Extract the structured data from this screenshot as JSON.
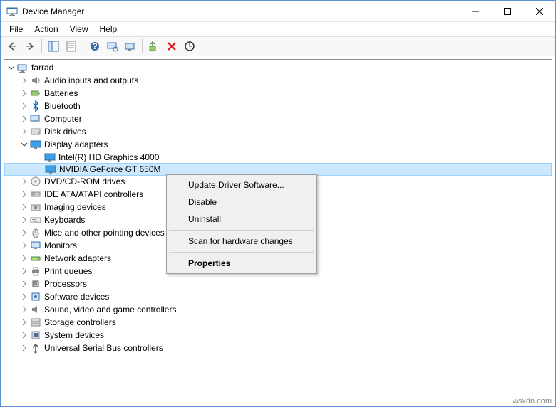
{
  "window": {
    "title": "Device Manager"
  },
  "menubar": {
    "file": "File",
    "action": "Action",
    "view": "View",
    "help": "Help"
  },
  "tree": {
    "root": "farrad",
    "items": [
      {
        "label": "Audio inputs and outputs",
        "icon": "audio",
        "expanded": false
      },
      {
        "label": "Batteries",
        "icon": "battery",
        "expanded": false
      },
      {
        "label": "Bluetooth",
        "icon": "bluetooth",
        "expanded": false
      },
      {
        "label": "Computer",
        "icon": "computer",
        "expanded": false
      },
      {
        "label": "Disk drives",
        "icon": "disk",
        "expanded": false
      },
      {
        "label": "Display adapters",
        "icon": "display",
        "expanded": true,
        "children": [
          {
            "label": "Intel(R) HD Graphics 4000",
            "icon": "display"
          },
          {
            "label": "NVIDIA GeForce GT 650M",
            "icon": "display",
            "selected": true
          }
        ]
      },
      {
        "label": "DVD/CD-ROM drives",
        "icon": "dvd",
        "expanded": false
      },
      {
        "label": "IDE ATA/ATAPI controllers",
        "icon": "ide",
        "expanded": false
      },
      {
        "label": "Imaging devices",
        "icon": "imaging",
        "expanded": false
      },
      {
        "label": "Keyboards",
        "icon": "keyboard",
        "expanded": false
      },
      {
        "label": "Mice and other pointing devices",
        "icon": "mouse",
        "expanded": false
      },
      {
        "label": "Monitors",
        "icon": "monitor",
        "expanded": false
      },
      {
        "label": "Network adapters",
        "icon": "network",
        "expanded": false
      },
      {
        "label": "Print queues",
        "icon": "printer",
        "expanded": false
      },
      {
        "label": "Processors",
        "icon": "processor",
        "expanded": false
      },
      {
        "label": "Software devices",
        "icon": "software",
        "expanded": false
      },
      {
        "label": "Sound, video and game controllers",
        "icon": "sound",
        "expanded": false
      },
      {
        "label": "Storage controllers",
        "icon": "storage",
        "expanded": false
      },
      {
        "label": "System devices",
        "icon": "system",
        "expanded": false
      },
      {
        "label": "Universal Serial Bus controllers",
        "icon": "usb",
        "expanded": false
      }
    ]
  },
  "context_menu": {
    "update": "Update Driver Software...",
    "disable": "Disable",
    "uninstall": "Uninstall",
    "scan": "Scan for hardware changes",
    "properties": "Properties"
  },
  "footer": "wsxdn.com"
}
